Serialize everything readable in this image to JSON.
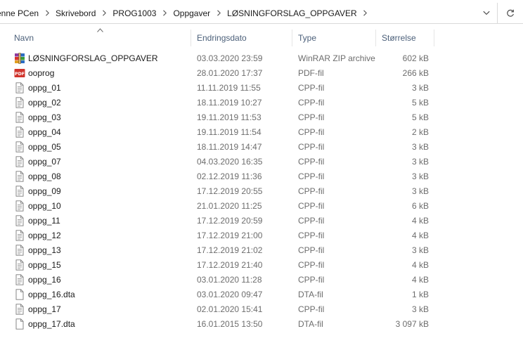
{
  "address_bar": {
    "crumbs": [
      "enne PCen",
      "Skrivebord",
      "PROG1003",
      "Oppgaver",
      "LØSNINGFORSLAG_OPPGAVER"
    ]
  },
  "columns": {
    "name": "Navn",
    "date": "Endringsdato",
    "type": "Type",
    "size": "Størrelse"
  },
  "files": [
    {
      "name": "LØSNINGFORSLAG_OPPGAVER",
      "date": "03.03.2020 23:59",
      "type": "WinRAR ZIP archive",
      "size": "602 kB",
      "icon": "winrar-archive-icon"
    },
    {
      "name": "ooprog",
      "date": "28.01.2020 17:37",
      "type": "PDF-fil",
      "size": "266 kB",
      "icon": "pdf-file-icon"
    },
    {
      "name": "oppg_01",
      "date": "11.11.2019 11:55",
      "type": "CPP-fil",
      "size": "3 kB",
      "icon": "text-file-icon"
    },
    {
      "name": "oppg_02",
      "date": "18.11.2019 10:27",
      "type": "CPP-fil",
      "size": "5 kB",
      "icon": "text-file-icon"
    },
    {
      "name": "oppg_03",
      "date": "19.11.2019 11:53",
      "type": "CPP-fil",
      "size": "5 kB",
      "icon": "text-file-icon"
    },
    {
      "name": "oppg_04",
      "date": "19.11.2019 11:54",
      "type": "CPP-fil",
      "size": "2 kB",
      "icon": "text-file-icon"
    },
    {
      "name": "oppg_05",
      "date": "18.11.2019 14:47",
      "type": "CPP-fil",
      "size": "3 kB",
      "icon": "text-file-icon"
    },
    {
      "name": "oppg_07",
      "date": "04.03.2020 16:35",
      "type": "CPP-fil",
      "size": "3 kB",
      "icon": "text-file-icon"
    },
    {
      "name": "oppg_08",
      "date": "02.12.2019 11:36",
      "type": "CPP-fil",
      "size": "3 kB",
      "icon": "text-file-icon"
    },
    {
      "name": "oppg_09",
      "date": "17.12.2019 20:55",
      "type": "CPP-fil",
      "size": "3 kB",
      "icon": "text-file-icon"
    },
    {
      "name": "oppg_10",
      "date": "21.01.2020 11:25",
      "type": "CPP-fil",
      "size": "6 kB",
      "icon": "text-file-icon"
    },
    {
      "name": "oppg_11",
      "date": "17.12.2019 20:59",
      "type": "CPP-fil",
      "size": "4 kB",
      "icon": "text-file-icon"
    },
    {
      "name": "oppg_12",
      "date": "17.12.2019 21:00",
      "type": "CPP-fil",
      "size": "4 kB",
      "icon": "text-file-icon"
    },
    {
      "name": "oppg_13",
      "date": "17.12.2019 21:02",
      "type": "CPP-fil",
      "size": "3 kB",
      "icon": "text-file-icon"
    },
    {
      "name": "oppg_15",
      "date": "17.12.2019 21:40",
      "type": "CPP-fil",
      "size": "4 kB",
      "icon": "text-file-icon"
    },
    {
      "name": "oppg_16",
      "date": "03.01.2020 11:28",
      "type": "CPP-fil",
      "size": "4 kB",
      "icon": "text-file-icon"
    },
    {
      "name": "oppg_16.dta",
      "date": "03.01.2020 09:47",
      "type": "DTA-fil",
      "size": "1 kB",
      "icon": "blank-file-icon"
    },
    {
      "name": "oppg_17",
      "date": "02.01.2020 15:41",
      "type": "CPP-fil",
      "size": "3 kB",
      "icon": "text-file-icon"
    },
    {
      "name": "oppg_17.dta",
      "date": "16.01.2015 13:50",
      "type": "DTA-fil",
      "size": "3 097 kB",
      "icon": "blank-file-icon"
    }
  ],
  "icons": {
    "pdf_badge_text": "PDF"
  },
  "colors": {
    "header_text": "#4c607a",
    "meta_text": "#6d6d6d",
    "pdf_red": "#d0342c"
  }
}
